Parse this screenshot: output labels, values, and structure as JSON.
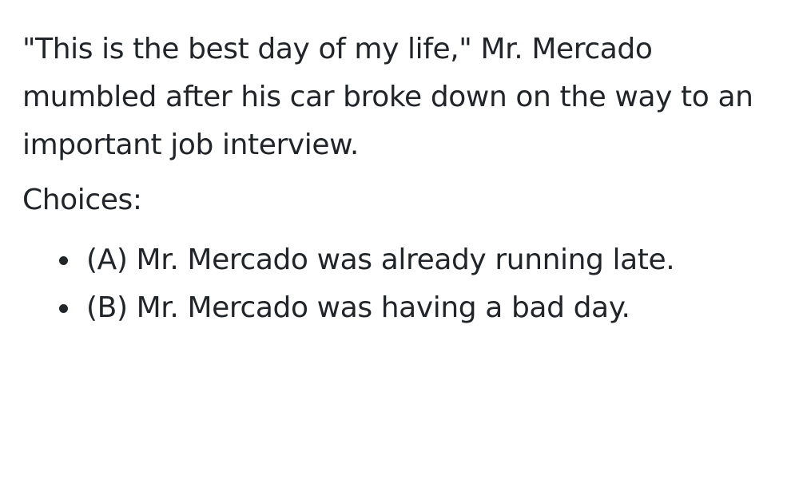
{
  "passage": "\"This is the best day of my life,\" Mr. Mercado mumbled after his car broke down on the way to an important job interview.",
  "choices_label": "Choices:",
  "choices": [
    {
      "text": "(A) Mr. Mercado was already running late."
    },
    {
      "text": "(B) Mr. Mercado was having a bad day."
    }
  ]
}
